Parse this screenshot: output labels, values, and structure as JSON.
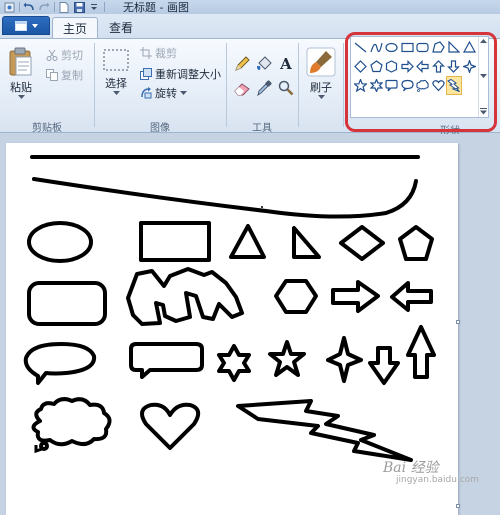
{
  "window": {
    "title": "无标题 - 画图"
  },
  "quick_access": {
    "icons": [
      "save-icon",
      "undo-icon",
      "redo-icon",
      "new-icon",
      "dropdown-icon"
    ]
  },
  "tabs": [
    {
      "label": "主页",
      "active": true
    },
    {
      "label": "查看",
      "active": false
    }
  ],
  "ribbon": {
    "clipboard": {
      "group_label": "剪贴板",
      "paste_label": "粘贴",
      "cut_label": "剪切",
      "copy_label": "复制"
    },
    "image": {
      "group_label": "图像",
      "select_label": "选择",
      "crop_label": "裁剪",
      "resize_label": "重新调整大小",
      "rotate_label": "旋转"
    },
    "tools": {
      "group_label": "工具",
      "items": [
        "pencil-icon",
        "fill-icon",
        "text-icon",
        "eraser-icon",
        "color-picker-icon",
        "magnifier-icon"
      ],
      "text_glyph": "A"
    },
    "brushes": {
      "label": "刷子"
    },
    "shapes": {
      "group_label": "形状",
      "items": [
        "line",
        "curve",
        "oval",
        "rectangle",
        "rounded-rectangle",
        "polygon",
        "right-triangle",
        "triangle",
        "diamond",
        "pentagon",
        "hexagon",
        "right-arrow",
        "left-arrow",
        "up-arrow",
        "down-arrow",
        "four-point-star",
        "five-point-star",
        "six-point-star",
        "rounded-callout",
        "oval-callout",
        "cloud-callout",
        "heart",
        "lightning"
      ],
      "selected": "lightning"
    }
  },
  "watermark": {
    "text": "Bai 经验",
    "sub": "jingyan.baidu.com"
  },
  "colors": {
    "accent": "#d5343a",
    "file_button": "#1b55a5"
  }
}
